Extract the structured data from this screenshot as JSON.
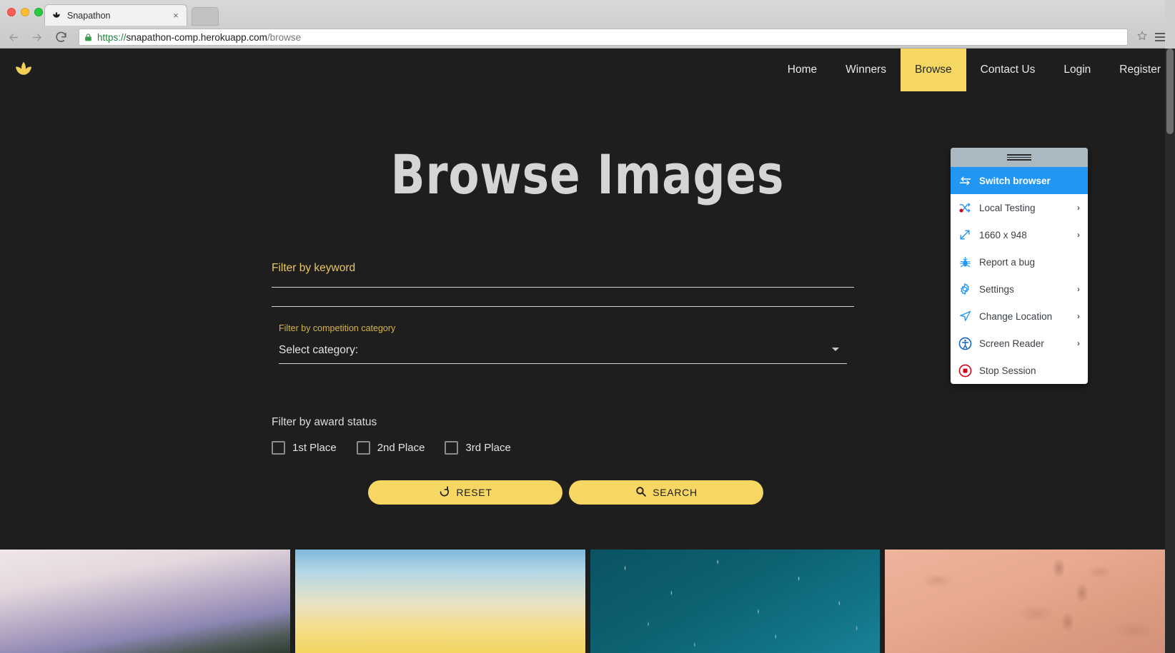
{
  "browser": {
    "tab": {
      "title": "Snapathon",
      "favicon": "lotus-icon",
      "close": "×"
    },
    "new_tab_label": "",
    "url": {
      "scheme": "https://",
      "host": "snapathon-comp.herokuapp.com",
      "path": "/browse"
    },
    "icons": {
      "back": "back-arrow-icon",
      "forward": "forward-arrow-icon",
      "reload": "reload-icon",
      "lock": "lock-icon",
      "bookmark": "star-icon",
      "menu": "hamburger-menu-icon"
    }
  },
  "site": {
    "logo": "lotus-logo-icon",
    "nav": [
      {
        "label": "Home",
        "active": false
      },
      {
        "label": "Winners",
        "active": false
      },
      {
        "label": "Browse",
        "active": true
      },
      {
        "label": "Contact Us",
        "active": false
      },
      {
        "label": "Login",
        "active": false
      },
      {
        "label": "Register",
        "active": false
      }
    ],
    "hero_title": "Browse Images"
  },
  "filters": {
    "keyword": {
      "label": "Filter by keyword",
      "value": "",
      "placeholder": ""
    },
    "category": {
      "label": "Filter by competition category",
      "selected": "Select category:",
      "caret": "chevron-down-icon"
    },
    "award": {
      "label": "Filter by award status",
      "options": [
        {
          "label": "1st Place",
          "checked": false
        },
        {
          "label": "2nd Place",
          "checked": false
        },
        {
          "label": "3rd Place",
          "checked": false
        }
      ]
    },
    "buttons": {
      "reset": {
        "label": "RESET",
        "icon": "reset-refresh-icon"
      },
      "search": {
        "label": "SEARCH",
        "icon": "search-magnifier-icon"
      }
    }
  },
  "gallery": {
    "tiles": [
      {
        "name": "mountain-landscape-thumbnail"
      },
      {
        "name": "sunset-sky-thumbnail"
      },
      {
        "name": "starry-teal-sky-thumbnail"
      },
      {
        "name": "desert-sand-footprints-thumbnail"
      }
    ]
  },
  "bs_panel": {
    "grip": "drag-handle-icon",
    "items": [
      {
        "label": "Switch browser",
        "icon": "switch-browser-icon",
        "active": true,
        "chevron": ""
      },
      {
        "label": "Local Testing",
        "icon": "local-testing-icon",
        "active": false,
        "chevron": "›"
      },
      {
        "label": "1660 x 948",
        "icon": "resize-icon",
        "active": false,
        "chevron": "›"
      },
      {
        "label": "Report a bug",
        "icon": "bug-icon",
        "active": false,
        "chevron": ""
      },
      {
        "label": "Settings",
        "icon": "gear-icon",
        "active": false,
        "chevron": "›"
      },
      {
        "label": "Change Location",
        "icon": "location-arrow-icon",
        "active": false,
        "chevron": "›"
      },
      {
        "label": "Screen Reader",
        "icon": "accessibility-icon",
        "active": false,
        "chevron": "›"
      },
      {
        "label": "Stop Session",
        "icon": "stop-session-icon",
        "active": false,
        "chevron": ""
      }
    ]
  },
  "colors": {
    "brand_yellow": "#f7d763",
    "page_bg": "#1e1e1e",
    "label_gold": "#e8c765",
    "panel_active_blue": "#2196f3",
    "panel_grip_gray": "#aab8c2"
  }
}
